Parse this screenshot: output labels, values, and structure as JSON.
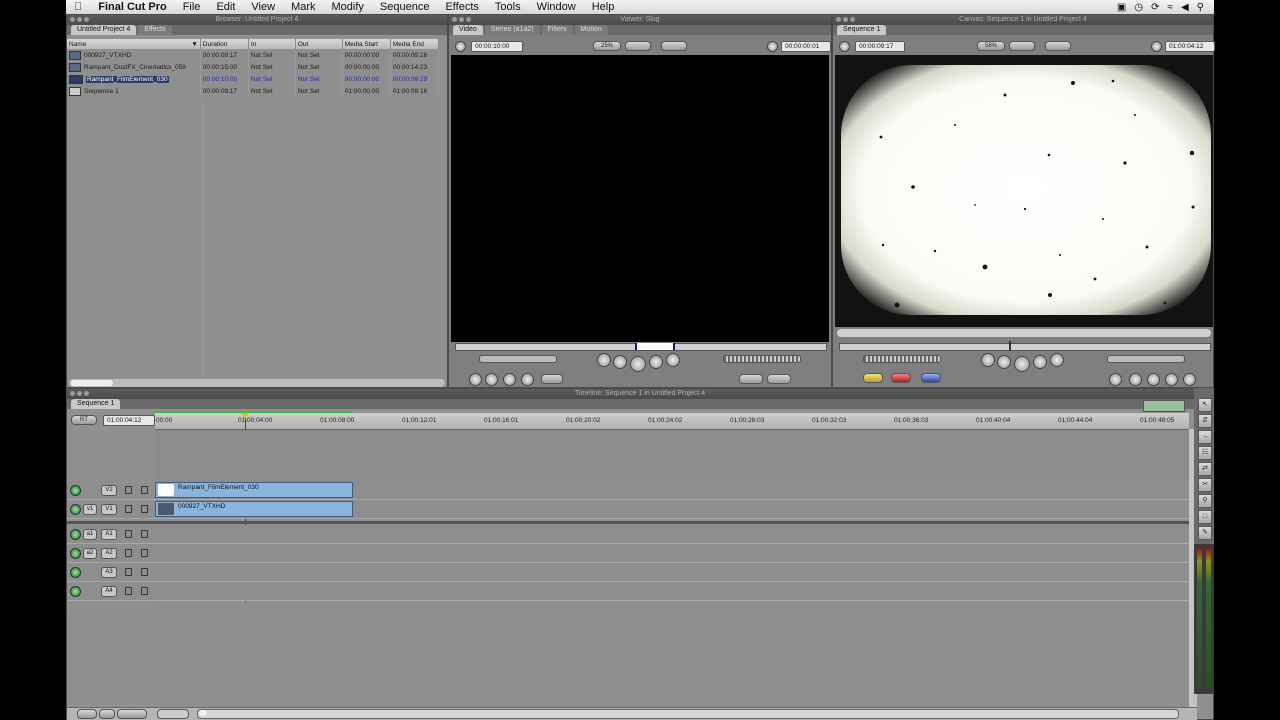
{
  "menubar": {
    "app_name": "Final Cut Pro",
    "items": [
      "File",
      "Edit",
      "View",
      "Mark",
      "Modify",
      "Sequence",
      "Effects",
      "Tools",
      "Window",
      "Help"
    ]
  },
  "browser": {
    "title": "Browser: Untitled Project 4",
    "tabs": [
      "Untitled Project 4",
      "Effects"
    ],
    "columns": [
      "Name",
      "Duration",
      "In",
      "Out",
      "Media Start",
      "Media End"
    ],
    "rows": [
      {
        "name": "000927_VTXHD",
        "duration": "00:00:09:17",
        "in": "Not Set",
        "out": "Not Set",
        "media_start": "00:00:00:00",
        "media_end": "00:00:09:16",
        "icon": "clip-icon"
      },
      {
        "name": "Rampant_DustFX_Cinematics_059",
        "duration": "00:00:15:00",
        "in": "Not Set",
        "out": "Not Set",
        "media_start": "00:00:00:00",
        "media_end": "00:00:14:23",
        "icon": "clip-icon"
      },
      {
        "name": "Rampant_FilmElement_030",
        "duration": "00:00:10:00",
        "in": "Not Set",
        "out": "Not Set",
        "media_start": "00:00:00:00",
        "media_end": "00:00:09:29",
        "icon": "clip-icon",
        "selected": true
      },
      {
        "name": "Sequence 1",
        "duration": "00:00:09:17",
        "in": "Not Set",
        "out": "Not Set",
        "media_start": "01:00:00:00",
        "media_end": "01:00:09:16",
        "icon": "sequence-icon"
      }
    ]
  },
  "viewer": {
    "title": "Viewer: Slug",
    "tabs": [
      "Video",
      "Stereo (a1a2)",
      "Filters",
      "Motion"
    ],
    "duration_tc": "00:00:10:00",
    "zoom": "25%",
    "current_tc": "00:00:00:01"
  },
  "canvas": {
    "title": "Canvas: Sequence 1 in Untitled Project 4",
    "tab": "Sequence 1",
    "duration_tc": "00:00:09:17",
    "zoom": "58%",
    "current_tc": "01:00:04:12"
  },
  "timeline": {
    "title": "Timeline: Sequence 1 in Untitled Project 4",
    "tab": "Sequence 1",
    "rt_label": "RT",
    "current_tc": "01:00:04:12",
    "ruler_labels": [
      "00:00",
      "01:00:04:00",
      "01:00:08:00",
      "01:00:12:01",
      "01:00:16:01",
      "01:00:20:02",
      "01:00:24:02",
      "01:00:28:03",
      "01:00:32:03",
      "01:00:36:03",
      "01:00:40:04",
      "01:00:44:04",
      "01:00:48:05"
    ],
    "video_tracks": [
      {
        "source": "",
        "dest": "V2",
        "clip": "Rampant_FilmElement_030"
      },
      {
        "source": "v1",
        "dest": "V1",
        "clip": "000927_VTXHD"
      }
    ],
    "audio_tracks": [
      {
        "source": "a1",
        "dest": "A1"
      },
      {
        "source": "a2",
        "dest": "A2"
      },
      {
        "source": "",
        "dest": "A3"
      },
      {
        "source": "",
        "dest": "A4"
      }
    ]
  },
  "colors": {
    "clip_blue": "#8ab4dc",
    "track_enabled_green": "#1d7d1d",
    "selection_blue": "#1b2fb0"
  }
}
